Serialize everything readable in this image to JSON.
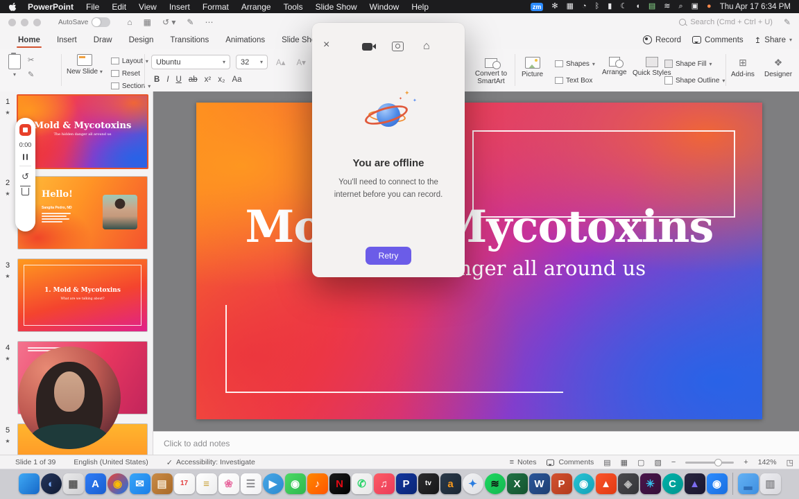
{
  "menu_bar": {
    "items": [
      "PowerPoint",
      "File",
      "Edit",
      "View",
      "Insert",
      "Format",
      "Arrange",
      "Tools",
      "Slide Show",
      "Window",
      "Help"
    ],
    "status": {
      "zoom_badge": "zm",
      "icons": [
        {
          "name": "fan-icon",
          "glyph": "✻"
        },
        {
          "name": "apps-icon",
          "glyph": "▦"
        },
        {
          "name": "timer-icon",
          "glyph": "◔"
        },
        {
          "name": "bluetooth-icon",
          "glyph": "ᛒ"
        },
        {
          "name": "battery-icon",
          "glyph": "▮"
        },
        {
          "name": "moon-icon",
          "glyph": "☾"
        },
        {
          "name": "audio-icon",
          "glyph": "◖"
        },
        {
          "name": "keyboard-icon",
          "glyph": "▤",
          "color": "#8ee08e"
        },
        {
          "name": "wifi-icon",
          "glyph": "≋"
        },
        {
          "name": "search-icon",
          "glyph": "⌕"
        },
        {
          "name": "display-icon",
          "glyph": "▣"
        },
        {
          "name": "siri-icon",
          "glyph": "●",
          "color": "#ff8a4c"
        }
      ],
      "clock": "Thu Apr 17 6:34 PM"
    }
  },
  "window": {
    "toolbar": {
      "autosave_label": "AutoSave",
      "search_placeholder": "Search (Cmd + Ctrl + U)"
    },
    "tabs": [
      {
        "label": "Home",
        "active": true
      },
      {
        "label": "Insert"
      },
      {
        "label": "Draw"
      },
      {
        "label": "Design"
      },
      {
        "label": "Transitions"
      },
      {
        "label": "Animations"
      },
      {
        "label": "Slide Show"
      }
    ],
    "actions": {
      "record": "Record",
      "comments": "Comments",
      "share": "Share"
    },
    "ribbon": {
      "new_slide": "New Slide",
      "layout": "Layout",
      "reset": "Reset",
      "section": "Section",
      "font_name": "Ubuntu",
      "font_size": "32",
      "format_buttons": [
        {
          "label": "B",
          "name": "bold-button"
        },
        {
          "label": "I",
          "name": "italic-button"
        },
        {
          "label": "U",
          "name": "underline-button"
        },
        {
          "label": "ab",
          "name": "strikethrough-button"
        },
        {
          "label": "x²",
          "name": "superscript-button"
        },
        {
          "label": "x₂",
          "name": "subscript-button"
        },
        {
          "label": "Aa",
          "name": "change-case-button"
        }
      ],
      "convert_smartart": "Convert to SmartArt",
      "picture": "Picture",
      "shapes": "Shapes",
      "text_box": "Text Box",
      "arrange": "Arrange",
      "quick_styles": "Quick Styles",
      "shape_fill": "Shape Fill",
      "shape_outline": "Shape Outline",
      "add_ins": "Add-ins",
      "designer": "Designer"
    }
  },
  "recording": {
    "time": "0:00"
  },
  "slides_panel": {
    "slides": [
      {
        "number": "1",
        "title": "Mold & Mycotoxins",
        "subtitle": "The hidden danger all around us"
      },
      {
        "number": "2",
        "title": "Hello!",
        "name": "Sangita Pedro, ND"
      },
      {
        "number": "3",
        "title": "1. Mold & Mycotoxins",
        "subtitle": "What are we talking about?"
      },
      {
        "number": "4"
      },
      {
        "number": "5"
      }
    ]
  },
  "slide": {
    "title": "Mold & Mycotoxins",
    "subtitle": "The hidden danger all around us"
  },
  "dialog": {
    "title": "You are offline",
    "body_line1": "You'll need to connect to the",
    "body_line2": "internet before you can record.",
    "retry": "Retry"
  },
  "notes": {
    "placeholder": "Click to add notes"
  },
  "status_bar": {
    "slide_indicator": "Slide 1 of 39",
    "language": "English (United States)",
    "accessibility": "Accessibility: Investigate",
    "notes": "Notes",
    "comments": "Comments",
    "zoom": "142%"
  },
  "dock": {
    "items": [
      {
        "name": "finder",
        "bg1": "#3fa9f5",
        "bg2": "#1668c8",
        "glyph": "",
        "fg": "#fff"
      },
      {
        "name": "navy-circle-app",
        "bg1": "#25355c",
        "bg2": "#101b33",
        "glyph": "◐",
        "fg": "#7fb0ff",
        "round": true
      },
      {
        "name": "launchpad",
        "bg1": "#e9e9ea",
        "bg2": "#cfcfd2",
        "glyph": "▦",
        "fg": "#555"
      },
      {
        "name": "app-store",
        "bg1": "#2f7cf6",
        "bg2": "#1a5fd0",
        "glyph": "A",
        "fg": "#fff"
      },
      {
        "name": "chrome",
        "bg1": "#ea4335",
        "bg2": "#1a73e8",
        "glyph": "◉",
        "fg": "#fbbc05",
        "round": true
      },
      {
        "name": "mail",
        "bg1": "#37a5f8",
        "bg2": "#1b7fe8",
        "glyph": "✉",
        "fg": "#fff"
      },
      {
        "name": "books",
        "bg1": "#c98b46",
        "bg2": "#a96a28",
        "glyph": "▤",
        "fg": "#f6e8d2"
      },
      {
        "name": "calendar",
        "bg1": "#ffffff",
        "bg2": "#f0f0f0",
        "glyph": "17",
        "fg": "#e23c3c"
      },
      {
        "name": "notes-app",
        "bg1": "#ffffff",
        "bg2": "#ededee",
        "glyph": "≡",
        "fg": "#c9a23a"
      },
      {
        "name": "photos",
        "bg1": "#ffffff",
        "bg2": "#f4f4f4",
        "glyph": "❀",
        "fg": "#e86ca0"
      },
      {
        "name": "reminders",
        "bg1": "#ffffff",
        "bg2": "#f1f1f3",
        "glyph": "☰",
        "fg": "#8a8a8e"
      },
      {
        "name": "telegram",
        "bg1": "#47a6e6",
        "bg2": "#2b8bd0",
        "glyph": "▶",
        "fg": "#fff",
        "round": true
      },
      {
        "name": "facetime",
        "bg1": "#4cd964",
        "bg2": "#2fb84f",
        "glyph": "◉",
        "fg": "#fff"
      },
      {
        "name": "soundcloud",
        "bg1": "#ff8800",
        "bg2": "#ff5500",
        "glyph": "♪",
        "fg": "#fff"
      },
      {
        "name": "netflix",
        "bg1": "#1b1b1b",
        "bg2": "#000000",
        "glyph": "N",
        "fg": "#e50914"
      },
      {
        "name": "whatsapp",
        "bg1": "#f5f5f5",
        "bg2": "#e8e8e8",
        "glyph": "✆",
        "fg": "#25d366"
      },
      {
        "name": "apple-music",
        "bg1": "#fc5c65",
        "bg2": "#eb3b5a",
        "glyph": "♫",
        "fg": "#fff"
      },
      {
        "name": "paypal",
        "bg1": "#12369e",
        "bg2": "#0a2575",
        "glyph": "P",
        "fg": "#fff"
      },
      {
        "name": "apple-tv",
        "bg1": "#2c2c2e",
        "bg2": "#161618",
        "glyph": "tv",
        "fg": "#fff"
      },
      {
        "name": "audible",
        "bg1": "#2b3a4a",
        "bg2": "#1a2734",
        "glyph": "a",
        "fg": "#f8991c"
      },
      {
        "name": "safari",
        "bg1": "#f2f2f4",
        "bg2": "#dfe0e4",
        "glyph": "✦",
        "fg": "#2b7de0",
        "round": true
      },
      {
        "name": "spotify",
        "bg1": "#1ed760",
        "bg2": "#14b850",
        "glyph": "≋",
        "fg": "#111",
        "round": true
      },
      {
        "name": "excel",
        "bg1": "#217346",
        "bg2": "#14532f",
        "glyph": "X",
        "fg": "#fff"
      },
      {
        "name": "word",
        "bg1": "#2b579a",
        "bg2": "#1e3f73",
        "glyph": "W",
        "fg": "#fff"
      },
      {
        "name": "powerpoint",
        "bg1": "#d35230",
        "bg2": "#b23a1d",
        "glyph": "P",
        "fg": "#fff"
      },
      {
        "name": "teal-circle-app",
        "bg1": "#27c3d4",
        "bg2": "#14a2b8",
        "glyph": "◉",
        "fg": "#fff",
        "round": true
      },
      {
        "name": "brave",
        "bg1": "#fb542b",
        "bg2": "#e03a12",
        "glyph": "▲",
        "fg": "#fff"
      },
      {
        "name": "gray-app",
        "bg1": "#4a4a4e",
        "bg2": "#343438",
        "glyph": "◈",
        "fg": "#bbb"
      },
      {
        "name": "slack",
        "bg1": "#4a154b",
        "bg2": "#35103a",
        "glyph": "✳",
        "fg": "#36c5f0"
      },
      {
        "name": "camtasia",
        "bg1": "#00b2a9",
        "bg2": "#00958f",
        "glyph": "C",
        "fg": "#fff",
        "round": true
      },
      {
        "name": "affinity",
        "bg1": "#2a2640",
        "bg2": "#1a1630",
        "glyph": "▲",
        "fg": "#7c6cf0"
      },
      {
        "name": "zoom",
        "bg1": "#2d8cff",
        "bg2": "#1a6fe0",
        "glyph": "◉",
        "fg": "#fff"
      },
      {
        "divider": true
      },
      {
        "name": "downloads-folder",
        "bg1": "#63b1f4",
        "bg2": "#3f8fe0",
        "glyph": "▂",
        "fg": "#2f6fb8"
      },
      {
        "name": "trash",
        "bg1": "#ececf0",
        "bg2": "#d9d9de",
        "glyph": "▥",
        "fg": "#8a8a8e"
      }
    ]
  },
  "colors": {
    "accent_powerpoint": "#d35230",
    "record_red": "#e8402a",
    "retry_purple": "#6b5ce8",
    "menubar": "#1c1c1e",
    "selected_thumb_border": "#e8562a"
  }
}
